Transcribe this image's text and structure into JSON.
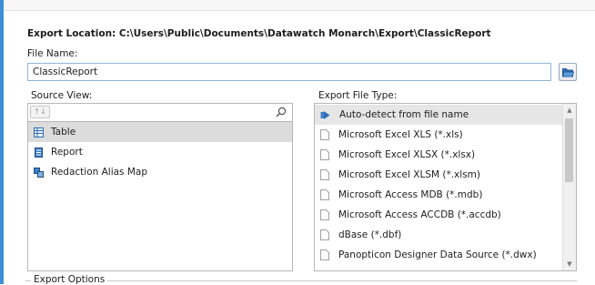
{
  "export_location": {
    "label": "Export Location:",
    "path": "C:\\Users\\Public\\Documents\\Datawatch Monarch\\Export\\ClassicReport"
  },
  "file_name": {
    "label": "File Name:",
    "value": "ClassicReport"
  },
  "source_view": {
    "label": "Source View:",
    "search_value": "",
    "items": [
      {
        "label": "Table",
        "icon": "table-icon",
        "selected": true
      },
      {
        "label": "Report",
        "icon": "report-icon",
        "selected": false
      },
      {
        "label": "Redaction Alias Map",
        "icon": "alias-map-icon",
        "selected": false
      }
    ]
  },
  "export_file_type": {
    "label": "Export File Type:",
    "items": [
      {
        "label": "Auto-detect from file name",
        "icon": "auto-detect-icon",
        "selected": true
      },
      {
        "label": "Microsoft Excel XLS (*.xls)",
        "icon": "file-icon",
        "selected": false
      },
      {
        "label": "Microsoft Excel XLSX (*.xlsx)",
        "icon": "file-icon",
        "selected": false
      },
      {
        "label": "Microsoft Excel XLSM (*.xlsm)",
        "icon": "file-icon",
        "selected": false
      },
      {
        "label": "Microsoft Access MDB (*.mdb)",
        "icon": "file-icon",
        "selected": false
      },
      {
        "label": "Microsoft Access ACCDB (*.accdb)",
        "icon": "file-icon",
        "selected": false
      },
      {
        "label": "dBase (*.dbf)",
        "icon": "file-icon",
        "selected": false
      },
      {
        "label": "Panopticon Designer Data Source (*.dwx)",
        "icon": "file-icon",
        "selected": false
      }
    ]
  },
  "export_options": {
    "label": "Export Options"
  },
  "colors": {
    "accent": "#3c8fd6",
    "selection": "#dcdcdc"
  }
}
